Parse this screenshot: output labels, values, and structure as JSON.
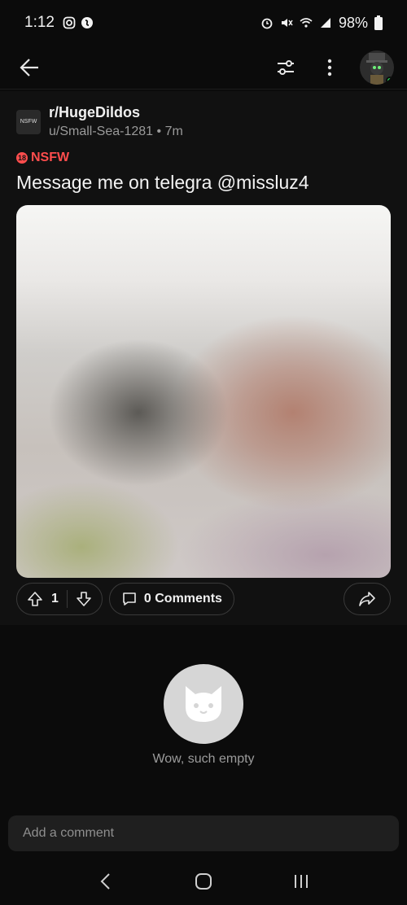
{
  "status": {
    "time": "1:12",
    "battery": "98%"
  },
  "header": {
    "avatar_name": "user-avatar"
  },
  "post": {
    "subreddit": "r/HugeDildos",
    "subreddit_icon_text": "NSFW",
    "author": "u/Small-Sea-1281",
    "time": "7m",
    "nsfw_badge": "18",
    "nsfw_label": "NSFW",
    "title": "Message me on telegra @missluz4",
    "score": "1",
    "comments_label": "0 Comments"
  },
  "empty_state": {
    "text": "Wow, such empty"
  },
  "comment_input": {
    "placeholder": "Add a comment"
  },
  "colors": {
    "background": "#0b0b0b",
    "post_background": "#111111",
    "nsfw": "#ff4d4d",
    "online": "#2bd85b"
  }
}
